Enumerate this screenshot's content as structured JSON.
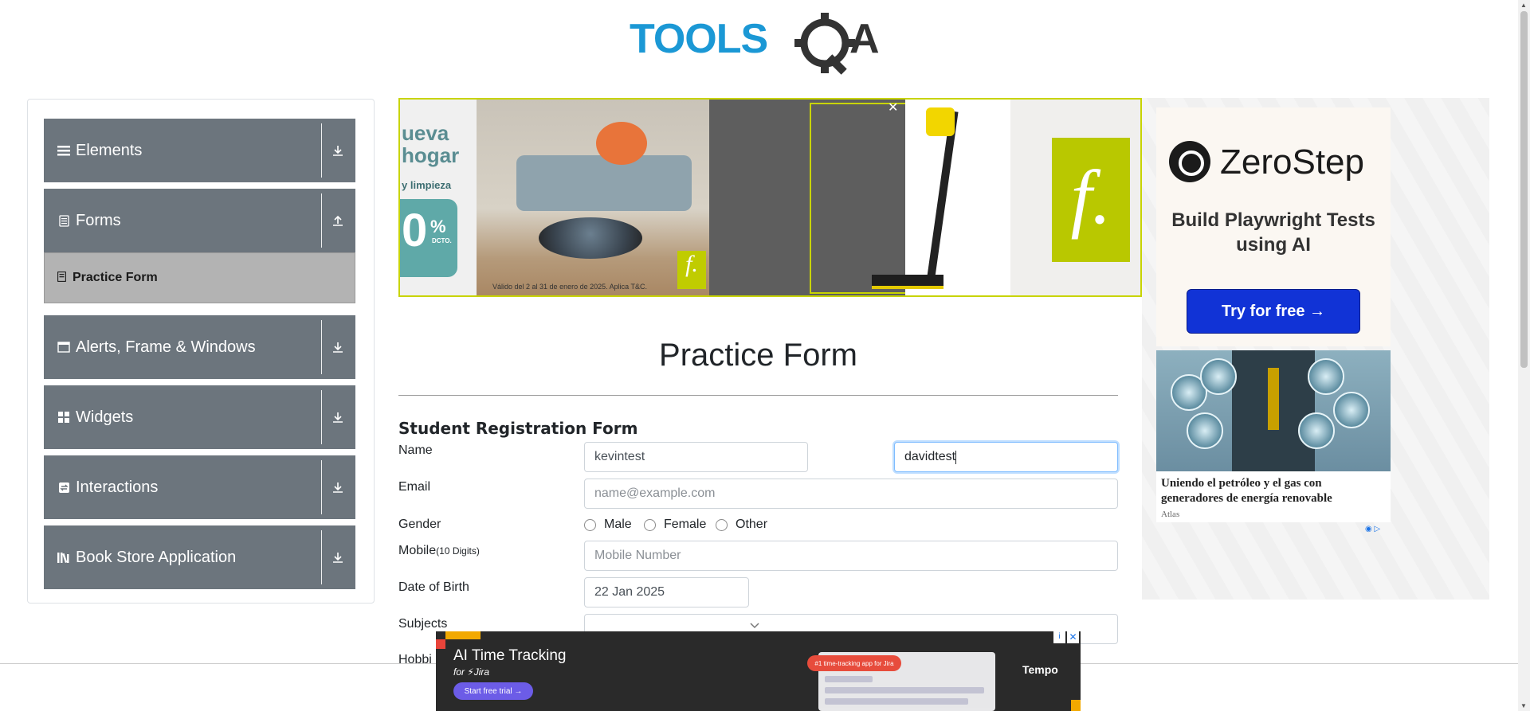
{
  "header": {
    "logo_text": "TOOLSQA"
  },
  "sidebar": {
    "groups": [
      {
        "label": "Elements",
        "icon": "hamburger-icon",
        "expanded": false
      },
      {
        "label": "Forms",
        "icon": "document-icon",
        "expanded": true,
        "items": [
          {
            "label": "Practice Form",
            "active": true
          }
        ]
      },
      {
        "label": "Alerts, Frame & Windows",
        "icon": "window-icon",
        "expanded": false
      },
      {
        "label": "Widgets",
        "icon": "widgets-icon",
        "expanded": false
      },
      {
        "label": "Interactions",
        "icon": "interactions-icon",
        "expanded": false
      },
      {
        "label": "Book Store Application",
        "icon": "books-icon",
        "expanded": false
      }
    ]
  },
  "top_ad": {
    "text1": "ueva\nhogar",
    "text2": "y limpieza",
    "percent": "0",
    "percent_small": "%",
    "percent_sub": "DCTO.",
    "fine_print": "Válido del 2 al 31 de enero de 2025. Aplica T&C.",
    "close": "✕",
    "logo_letter": "f."
  },
  "right_ad": {
    "brand": "ZeroStep",
    "tagline": "Build Playwright Tests using AI",
    "cta": "Try for free →",
    "article_title": "Uniendo el petróleo y el gas con generadores de energía renovable",
    "article_source": "Atlas"
  },
  "form": {
    "page_title": "Practice Form",
    "heading": "Student Registration Form",
    "name_label": "Name",
    "first_name_value": "kevintest",
    "last_name_value": "davidtest",
    "email_label": "Email",
    "email_placeholder": "name@example.com",
    "gender_label": "Gender",
    "gender_options": [
      "Male",
      "Female",
      "Other"
    ],
    "mobile_label": "Mobile",
    "mobile_hint": "(10 Digits)",
    "mobile_placeholder": "Mobile Number",
    "dob_label": "Date of Birth",
    "dob_value": "22 Jan 2025",
    "subjects_label": "Subjects",
    "hobbies_label": "Hobbi"
  },
  "bottom_ad": {
    "title": "AI Time Tracking",
    "subtitle": "for ⚡Jira",
    "cta": "Start free trial →",
    "pill": "#1 time-tracking app for Jira",
    "brand": "Tempo"
  }
}
